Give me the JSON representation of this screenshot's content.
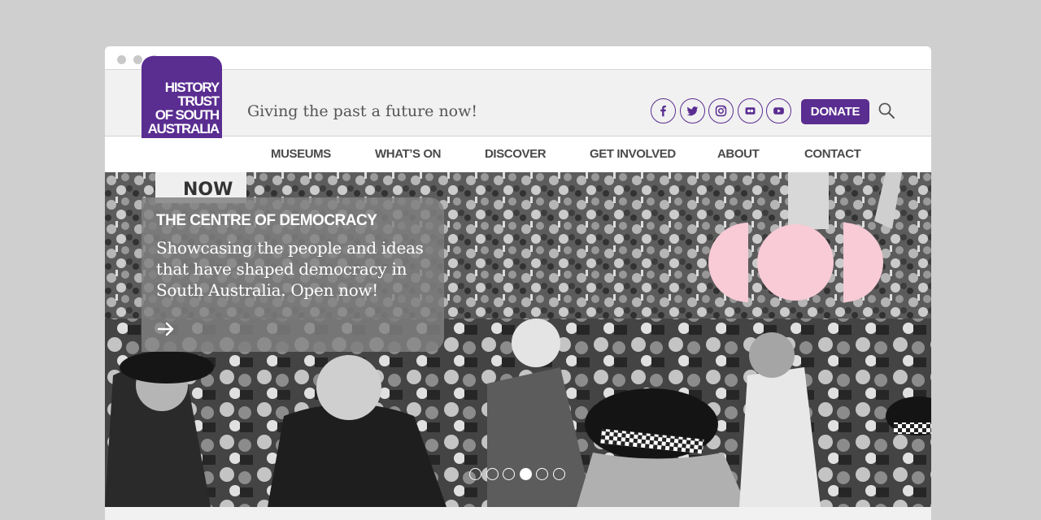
{
  "logo": {
    "lines": [
      "HISTORY",
      "TRUST",
      "OF SOUTH",
      "AUSTRALIA"
    ]
  },
  "header": {
    "tagline": "Giving the past a future now!",
    "social": [
      "facebook-icon",
      "twitter-icon",
      "instagram-icon",
      "flickr-icon",
      "youtube-icon"
    ],
    "donate_label": "DONATE"
  },
  "nav": {
    "items": [
      "MUSEUMS",
      "WHAT’S ON",
      "DISCOVER",
      "GET INVOLVED",
      "ABOUT",
      "CONTACT"
    ]
  },
  "hero": {
    "sign_text": "NOW",
    "promo": {
      "title": "THE CENTRE OF DEMOCRACY",
      "text": "Showcasing the people and ideas that have shaped democracy in South Australia. Open now!"
    },
    "slides_total": 6,
    "active_slide": 4
  },
  "colors": {
    "brand": "#5a2d91",
    "accent_pink": "#f8cbd6",
    "background": "#f1f1f1"
  }
}
